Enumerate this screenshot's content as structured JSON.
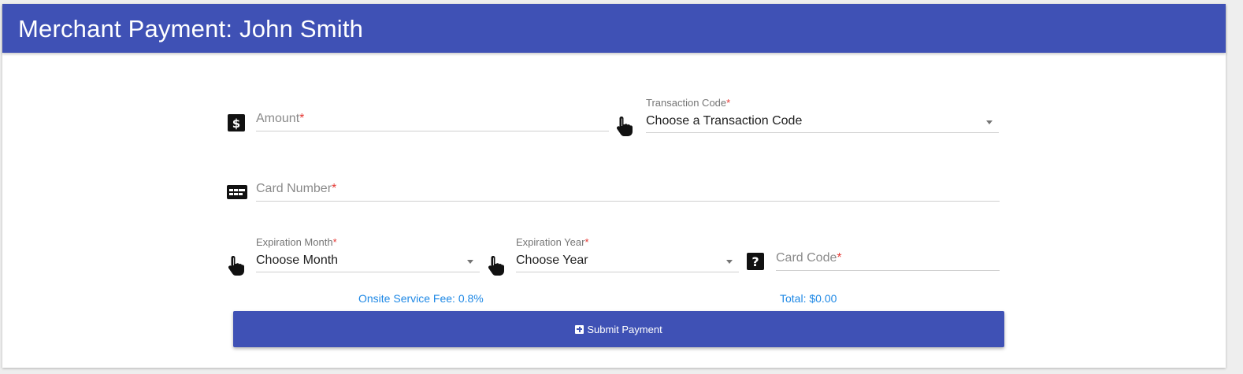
{
  "colors": {
    "primary": "#3f51b5",
    "accent": "#1e88e5",
    "required": "#e53935"
  },
  "header": {
    "title": "Merchant Payment: John Smith"
  },
  "form": {
    "amount": {
      "placeholder": "Amount",
      "required_mark": "*",
      "icon": "dollar-sign-icon"
    },
    "transaction_code": {
      "label": "Transaction Code",
      "required_mark": "*",
      "value": "Choose a Transaction Code",
      "icon": "pointer-hand-icon"
    },
    "card_number": {
      "placeholder": "Card Number",
      "required_mark": "*",
      "icon": "credit-card-icon"
    },
    "expiration_month": {
      "label": "Expiration Month",
      "required_mark": "*",
      "value": "Choose Month",
      "icon": "pointer-hand-icon"
    },
    "expiration_year": {
      "label": "Expiration Year",
      "required_mark": "*",
      "value": "Choose Year",
      "icon": "pointer-hand-icon"
    },
    "card_code": {
      "placeholder": "Card Code",
      "required_mark": "*",
      "icon": "question-mark-icon"
    }
  },
  "summary": {
    "fee": "Onsite Service Fee: 0.8%",
    "total": "Total: $0.00"
  },
  "submit": {
    "label": "Submit Payment",
    "icon": "plus-square-icon"
  }
}
